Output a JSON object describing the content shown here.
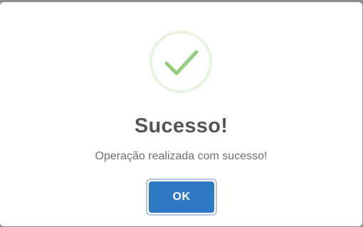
{
  "dialog": {
    "icon": "success-check-icon",
    "title": "Sucesso!",
    "message": "Operação realizada com sucesso!",
    "ok_label": "OK"
  },
  "colors": {
    "accent": "#2f78c4",
    "success": "#8fd17a",
    "success_ring": "#e7f4e0",
    "title": "#545454",
    "message": "#707070"
  }
}
